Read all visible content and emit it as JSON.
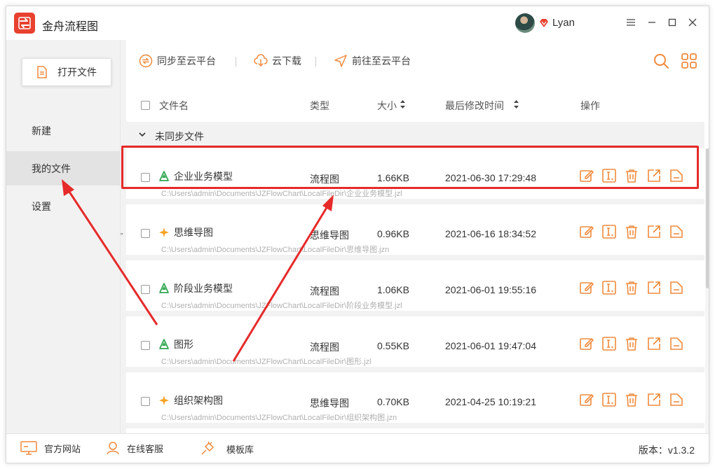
{
  "app": {
    "title": "金舟流程图",
    "user_name": "Lyan"
  },
  "colors": {
    "accent": "#f08a3c",
    "highlight": "#e62a2a",
    "flowchart_icon": "#33a852",
    "mindmap_icon": "#f5a623"
  },
  "sidebar": {
    "open_button": "打开文件",
    "items": [
      {
        "label": "新建",
        "active": false
      },
      {
        "label": "我的文件",
        "active": true
      },
      {
        "label": "设置",
        "active": false
      }
    ]
  },
  "toolbar": {
    "sync": "同步至云平台",
    "download": "云下载",
    "goto": "前往至云平台"
  },
  "columns": {
    "name": "文件名",
    "type": "类型",
    "size": "大小",
    "mtime": "最后修改时间",
    "ops": "操作"
  },
  "group": {
    "label": "未同步文件"
  },
  "files": [
    {
      "name": "企业业务模型",
      "icon": "flowchart-icon",
      "path": "C:\\Users\\admin\\Documents\\JZFlowChart\\LocalFileDir\\企业业务模型.jzl",
      "type": "流程图",
      "size": "1.66KB",
      "mtime": "2021-06-30 17:29:48"
    },
    {
      "name": "思维导图",
      "icon": "mindmap-icon",
      "path": "C:\\Users\\admin\\Documents\\JZFlowChart\\LocalFileDir\\思维导图.jzn",
      "type": "思维导图",
      "size": "0.96KB",
      "mtime": "2021-06-16 18:34:52"
    },
    {
      "name": "阶段业务模型",
      "icon": "flowchart-icon",
      "path": "C:\\Users\\admin\\Documents\\JZFlowChart\\LocalFileDir\\阶段业务模型.jzl",
      "type": "流程图",
      "size": "1.06KB",
      "mtime": "2021-06-01 19:55:16"
    },
    {
      "name": "图形",
      "icon": "flowchart-icon",
      "path": "C:\\Users\\admin\\Documents\\JZFlowChart\\LocalFileDir\\图形.jzl",
      "type": "流程图",
      "size": "0.55KB",
      "mtime": "2021-06-01 19:47:04"
    },
    {
      "name": "组织架构图",
      "icon": "mindmap-icon",
      "path": "C:\\Users\\admin\\Documents\\JZFlowChart\\LocalFileDir\\组织架构图.jzn",
      "type": "思维导图",
      "size": "0.70KB",
      "mtime": "2021-04-25 10:19:21"
    }
  ],
  "footer": {
    "website": "官方网站",
    "support": "在线客服",
    "templates": "模板库",
    "version": "版本：v1.3.2"
  }
}
